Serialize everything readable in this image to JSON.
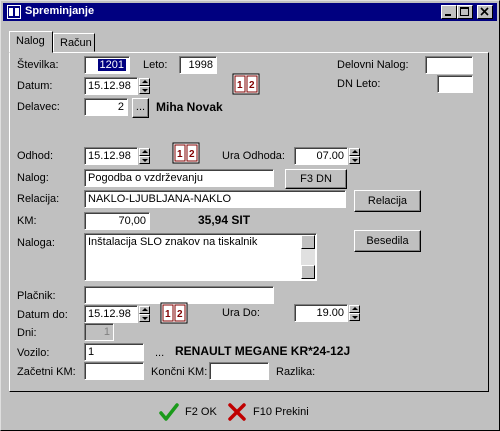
{
  "window": {
    "title": "Spreminjanje"
  },
  "tabs": [
    {
      "label": "Nalog"
    },
    {
      "label": "Račun"
    }
  ],
  "fields": {
    "stevilka": {
      "label": "Številka:",
      "value": "1201"
    },
    "leto": {
      "label": "Leto:",
      "value": "1998"
    },
    "delovni_nalog": {
      "label": "Delovni Nalog:",
      "value": ""
    },
    "dn_leto": {
      "label": "DN Leto:",
      "value": ""
    },
    "datum": {
      "label": "Datum:",
      "value": "15.12.98"
    },
    "delavec": {
      "label": "Delavec:",
      "value": "2",
      "name": "Miha Novak",
      "lookup": "..."
    },
    "odhod": {
      "label": "Odhod:",
      "value": "15.12.98"
    },
    "ura_odhoda": {
      "label": "Ura Odhoda:",
      "value": "07.00"
    },
    "nalog": {
      "label": "Nalog:",
      "value": "Pogodba o vzdrževanju"
    },
    "relacija": {
      "label": "Relacija:",
      "value": "NAKLO-LJUBLJANA-NAKLO"
    },
    "km": {
      "label": "KM:",
      "value": "70,00",
      "amount": "35,94 SIT"
    },
    "naloga": {
      "label": "Naloga:",
      "value": "Inštalacija SLO znakov na tiskalnik"
    },
    "placnik": {
      "label": "Plačnik:",
      "value": ""
    },
    "datum_do": {
      "label": "Datum do:",
      "value": "15.12.98"
    },
    "ura_do": {
      "label": "Ura Do:",
      "value": "19.00"
    },
    "dni": {
      "label": "Dni:",
      "value": "1"
    },
    "vozilo": {
      "label": "Vozilo:",
      "value": "1",
      "lookup": "...",
      "name": "RENAULT MEGANE KR*24-12J"
    },
    "zacetni_km": {
      "label": "Začetni KM:",
      "value": ""
    },
    "koncni_km": {
      "label": "Končni KM:",
      "value": ""
    },
    "razlika": {
      "label": "Razlika:"
    }
  },
  "buttons": {
    "f3dn": "F3 DN",
    "relacija": "Relacija",
    "besedila": "Besedila",
    "ok": "F2 OK",
    "prekini": "F10 Prekini"
  },
  "colors": {
    "titlebar": "#000080",
    "ok_check": "#1a9a1a",
    "cancel_x": "#c00000"
  }
}
